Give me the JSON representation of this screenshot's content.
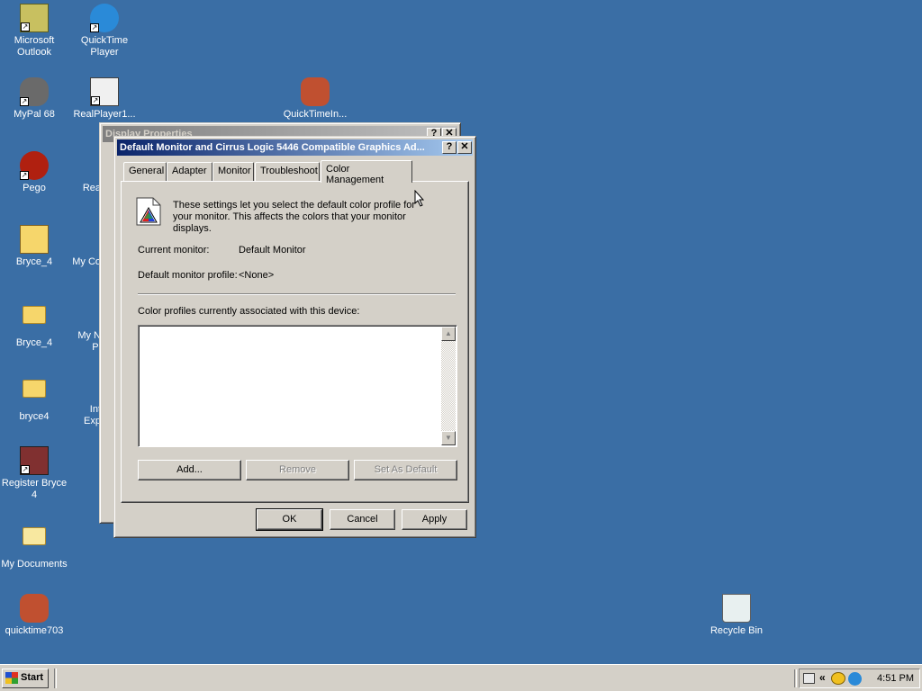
{
  "desktop": {
    "icons": [
      {
        "label": "Microsoft Outlook",
        "icon": "outlook-icon"
      },
      {
        "label": "QuickTime Player",
        "icon": "quicktime-icon"
      },
      {
        "label": "MyPal 68",
        "icon": "mypal-icon"
      },
      {
        "label": "RealPlayer1...",
        "icon": "realplayer-icon"
      },
      {
        "label": "QuickTimeIn...",
        "icon": "quicktime-installer-icon"
      },
      {
        "label": "Pego",
        "icon": "pego-icon"
      },
      {
        "label": "Rea",
        "icon": "realplayer-partial-icon"
      },
      {
        "label": "Bryce_4",
        "icon": "iso-icon"
      },
      {
        "label": "My Co",
        "icon": "my-computer-icon"
      },
      {
        "label": "Bryce_4",
        "icon": "folder-icon"
      },
      {
        "label": "My N Pl",
        "icon": "my-network-icon"
      },
      {
        "label": "bryce4",
        "icon": "folder-icon"
      },
      {
        "label": "Int Exp",
        "icon": "internet-explorer-icon"
      },
      {
        "label": "Register Bryce 4",
        "icon": "register-icon"
      },
      {
        "label": "My Documents",
        "icon": "my-documents-icon"
      },
      {
        "label": "quicktime703",
        "icon": "quicktime-installer-icon"
      },
      {
        "label": "Recycle Bin",
        "icon": "recycle-bin-icon"
      }
    ]
  },
  "back_window": {
    "title": "Display Properties"
  },
  "dialog": {
    "title": "Default Monitor and Cirrus Logic 5446 Compatible Graphics Ad...",
    "help_btn": "?",
    "close_btn": "✕",
    "tabs": [
      "General",
      "Adapter",
      "Monitor",
      "Troubleshoot",
      "Color Management"
    ],
    "active_tab": "Color Management",
    "description": "These settings let you select the default color profile for your monitor. This affects the colors that your monitor displays.",
    "current_monitor_label": "Current monitor:",
    "current_monitor_value": "Default Monitor",
    "default_profile_label": "Default monitor profile:",
    "default_profile_value": "<None>",
    "profiles_label": "Color profiles currently associated with this device:",
    "add_btn": "Add...",
    "remove_btn": "Remove",
    "set_default_btn": "Set As Default",
    "ok_btn": "OK",
    "cancel_btn": "Cancel",
    "apply_btn": "Apply"
  },
  "taskbar": {
    "start_label": "Start",
    "clock": "4:51 PM",
    "tray_expand": "«"
  }
}
